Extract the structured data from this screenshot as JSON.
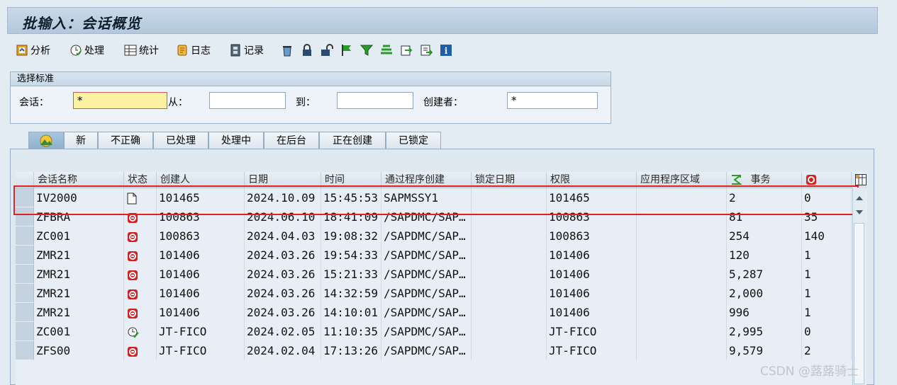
{
  "title": "批输入：会话概览",
  "toolbar": {
    "analyze": "分析",
    "process": "处理",
    "statistics": "统计",
    "log": "日志",
    "record": "记录"
  },
  "selection": {
    "header": "选择标准",
    "session_label": "会话：",
    "session_value": "*",
    "from_label": "从：",
    "from_value": "",
    "to_label": "到：",
    "to_value": "",
    "creator_label": "创建者：",
    "creator_value": "*"
  },
  "tabs": [
    "",
    "新",
    "不正确",
    "已处理",
    "处理中",
    "在后台",
    "正在创建",
    "已锁定"
  ],
  "table": {
    "headers": [
      "会话名称",
      "状态",
      "创建人",
      "日期",
      "时间",
      "通过程序创建",
      "锁定日期",
      "权限",
      "应用程序区域",
      "事务",
      ""
    ],
    "rows": [
      [
        "IV2000",
        "new",
        "101465",
        "2024.10.09",
        "15:45:53",
        "SAPMSSY1",
        "",
        "101465",
        "",
        "2",
        "0"
      ],
      [
        "ZFBRA",
        "error",
        "100863",
        "2024.06.10",
        "18:41:09",
        "/SAPDMC/SAP…",
        "",
        "100863",
        "",
        "81",
        "35"
      ],
      [
        "ZC001",
        "error",
        "100863",
        "2024.04.03",
        "19:08:32",
        "/SAPDMC/SAP…",
        "",
        "100863",
        "",
        "254",
        "140"
      ],
      [
        "ZMR21",
        "error",
        "101406",
        "2024.03.26",
        "19:54:33",
        "/SAPDMC/SAP…",
        "",
        "101406",
        "",
        "120",
        "1"
      ],
      [
        "ZMR21",
        "error",
        "101406",
        "2024.03.26",
        "15:21:33",
        "/SAPDMC/SAP…",
        "",
        "101406",
        "",
        "5,287",
        "1"
      ],
      [
        "ZMR21",
        "error",
        "101406",
        "2024.03.26",
        "14:32:59",
        "/SAPDMC/SAP…",
        "",
        "101406",
        "",
        "2,000",
        "1"
      ],
      [
        "ZMR21",
        "error",
        "101406",
        "2024.03.26",
        "14:10:01",
        "/SAPDMC/SAP…",
        "",
        "101406",
        "",
        "996",
        "1"
      ],
      [
        "ZC001",
        "processed",
        "JT-FICO",
        "2024.02.05",
        "11:10:35",
        "/SAPDMC/SAP…",
        "",
        "JT-FICO",
        "",
        "2,995",
        "0"
      ],
      [
        "ZFS00",
        "error",
        "JT-FICO",
        "2024.02.04",
        "17:13:26",
        "/SAPDMC/SAP…",
        "",
        "JT-FICO",
        "",
        "9,579",
        "2"
      ]
    ]
  },
  "watermark": "CSDN @蕗蕗骑士",
  "colors": {
    "highlight_box": "#e0231f",
    "error_icon": "#d42020"
  }
}
